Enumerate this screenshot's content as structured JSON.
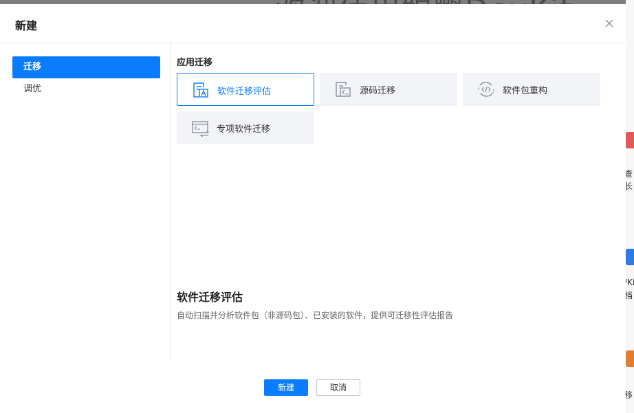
{
  "dialog": {
    "title": "新建",
    "close_icon": "close-icon"
  },
  "sidebar": {
    "items": [
      {
        "label": "迁移",
        "active": true
      },
      {
        "label": "调优",
        "active": false
      }
    ]
  },
  "section": {
    "title": "应用迁移"
  },
  "cards": [
    {
      "label": "软件迁移评估",
      "icon": "migration-assessment-icon",
      "selected": true
    },
    {
      "label": "源码迁移",
      "icon": "source-code-icon",
      "selected": false
    },
    {
      "label": "软件包重构",
      "icon": "code-package-icon",
      "selected": false
    },
    {
      "label": "专项软件迁移",
      "icon": "special-software-icon",
      "selected": false
    }
  ],
  "description": {
    "title": "软件迁移评估",
    "text": "自动扫描并分析软件包（非源码包）、已安装的软件，提供可迁移性评估报告"
  },
  "footer": {
    "create_label": "新建",
    "cancel_label": "取消"
  },
  "background": {
    "right_texts": [
      "查",
      "长",
      "/Ki",
      "档",
      "移"
    ]
  },
  "colors": {
    "accent": "#0a7cff",
    "card_bg": "#f3f4f7"
  }
}
